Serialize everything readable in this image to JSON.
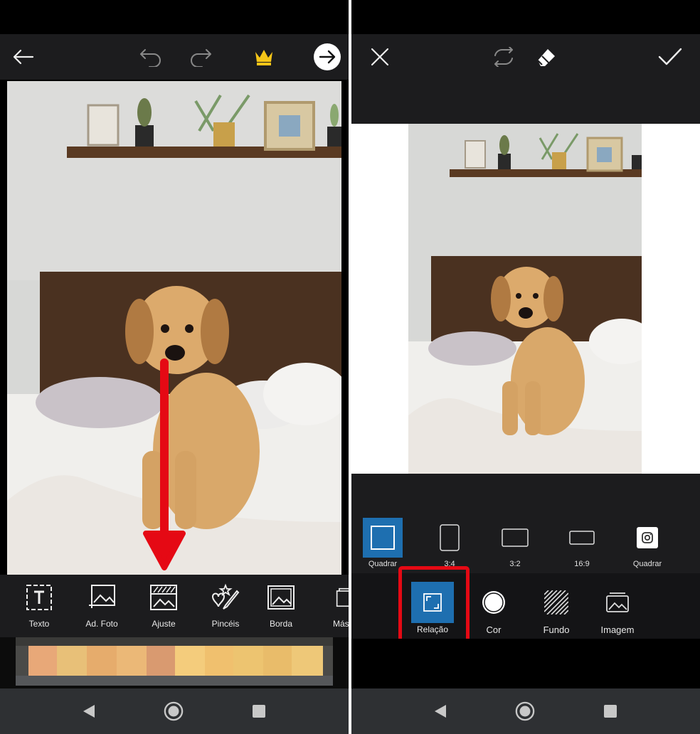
{
  "left": {
    "tools": [
      {
        "label": "Texto",
        "icon": "text-icon"
      },
      {
        "label": "Ad. Foto",
        "icon": "add-photo-icon"
      },
      {
        "label": "Ajuste",
        "icon": "adjust-icon"
      },
      {
        "label": "Pincéis",
        "icon": "brushes-icon"
      },
      {
        "label": "Borda",
        "icon": "border-icon"
      },
      {
        "label": "Más",
        "icon": "more-icon"
      }
    ],
    "annotation_color": "#e50914",
    "crown_color": "#f5c518"
  },
  "right": {
    "ratios": [
      {
        "label": "Quadrar",
        "icon": "square-ratio-icon",
        "selected": true
      },
      {
        "label": "3:4",
        "icon": "ratio-3-4-icon"
      },
      {
        "label": "3:2",
        "icon": "ratio-3-2-icon"
      },
      {
        "label": "16:9",
        "icon": "ratio-16-9-icon"
      },
      {
        "label": "Quadrar",
        "icon": "instagram-icon"
      }
    ],
    "tabs": [
      {
        "label": "Relação",
        "icon": "ratio-frame-icon",
        "selected": true
      },
      {
        "label": "Cor",
        "icon": "color-circle-icon"
      },
      {
        "label": "Fundo",
        "icon": "background-pattern-icon"
      },
      {
        "label": "Imagem",
        "icon": "image-icon"
      }
    ],
    "selected_color": "#1e6fb0",
    "annotation_color": "#e50914"
  }
}
